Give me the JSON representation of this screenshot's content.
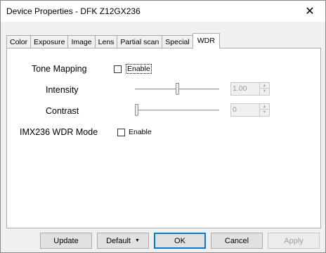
{
  "window": {
    "title": "Device Properties - DFK Z12GX236",
    "close_glyph": "✕"
  },
  "tabs": [
    {
      "label": "Color"
    },
    {
      "label": "Exposure"
    },
    {
      "label": "Image"
    },
    {
      "label": "Lens"
    },
    {
      "label": "Partial scan"
    },
    {
      "label": "Special"
    },
    {
      "label": "WDR"
    }
  ],
  "active_tab": "WDR",
  "wdr": {
    "tone_mapping": {
      "label": "Tone Mapping",
      "enable_label": "Enable",
      "enabled": false
    },
    "intensity": {
      "label": "Intensity",
      "slider_fraction": 0.5,
      "value": "1.00"
    },
    "contrast": {
      "label": "Contrast",
      "slider_fraction": 0.0,
      "value": "0"
    },
    "imx236_mode": {
      "label": "IMX236 WDR Mode",
      "enable_label": "Enable",
      "enabled": false
    }
  },
  "buttons": {
    "update": "Update",
    "default": "Default",
    "default_caret": "▼",
    "ok": "OK",
    "cancel": "Cancel",
    "apply": "Apply"
  },
  "colors": {
    "focus_border": "#0078d7",
    "dialog_bg": "#f0f0f0"
  }
}
